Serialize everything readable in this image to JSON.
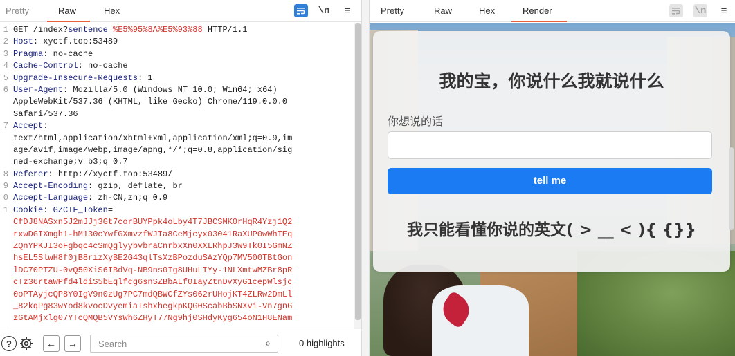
{
  "left_tabs": [
    "Pretty",
    "Raw",
    "Hex"
  ],
  "left_active_tab": "Raw",
  "left_toolbar": {
    "wrap_icon": "wrap-lines-icon",
    "newline_label": "\\n",
    "menu_icon": "hamburger-menu-icon"
  },
  "request_lines": [
    {
      "num": "1",
      "parts": [
        [
          "GET /index?",
          ""
        ],
        [
          "sentence",
          "qparam"
        ],
        [
          "=",
          ""
        ],
        [
          "%E5%95%8A%E5%93%88",
          "qval"
        ],
        [
          " HTTP/1.1",
          ""
        ]
      ]
    },
    {
      "num": "2",
      "parts": [
        [
          "Host",
          "hname"
        ],
        [
          ": xyctf.top:53489",
          ""
        ]
      ]
    },
    {
      "num": "3",
      "parts": [
        [
          "Pragma",
          "hname"
        ],
        [
          ": no-cache",
          ""
        ]
      ]
    },
    {
      "num": "4",
      "parts": [
        [
          "Cache-Control",
          "hname"
        ],
        [
          ": no-cache",
          ""
        ]
      ]
    },
    {
      "num": "5",
      "parts": [
        [
          "Upgrade-Insecure-Requests",
          "hname"
        ],
        [
          ": 1",
          ""
        ]
      ]
    },
    {
      "num": "6",
      "parts": [
        [
          "User-Agent",
          "hname"
        ],
        [
          ": Mozilla/5.0 (Windows NT 10.0; Win64; x64)",
          ""
        ]
      ]
    },
    {
      "num": "",
      "parts": [
        [
          "AppleWebKit/537.36 (KHTML, like Gecko) Chrome/119.0.0.0",
          ""
        ]
      ]
    },
    {
      "num": "",
      "parts": [
        [
          "Safari/537.36",
          ""
        ]
      ]
    },
    {
      "num": "7",
      "parts": [
        [
          "Accept",
          "hname"
        ],
        [
          ":",
          ""
        ]
      ]
    },
    {
      "num": "",
      "parts": [
        [
          "text/html,application/xhtml+xml,application/xml;q=0.9,im",
          ""
        ]
      ]
    },
    {
      "num": "",
      "parts": [
        [
          "age/avif,image/webp,image/apng,*/*;q=0.8,application/sig",
          ""
        ]
      ]
    },
    {
      "num": "",
      "parts": [
        [
          "ned-exchange;v=b3;q=0.7",
          ""
        ]
      ]
    },
    {
      "num": "8",
      "parts": [
        [
          "Referer",
          "hname"
        ],
        [
          ": http://xyctf.top:53489/",
          ""
        ]
      ]
    },
    {
      "num": "9",
      "parts": [
        [
          "Accept-Encoding",
          "hname"
        ],
        [
          ": gzip, deflate, br",
          ""
        ]
      ]
    },
    {
      "num": "0",
      "parts": [
        [
          "Accept-Language",
          "hname"
        ],
        [
          ": zh-CN,zh;q=0.9",
          ""
        ]
      ]
    },
    {
      "num": "1",
      "parts": [
        [
          "Cookie",
          "hname"
        ],
        [
          ": ",
          ""
        ],
        [
          "GZCTF_Token",
          "hname"
        ],
        [
          "=",
          ""
        ]
      ]
    },
    {
      "num": "",
      "parts": [
        [
          "CfDJ8NASxn5J2mJJj3Gt7corBUYPpk4oLby4T7JBCSMK0rHqR4Yzj1Q2",
          "cookie"
        ]
      ]
    },
    {
      "num": "",
      "parts": [
        [
          "rxwDGIXmgh1-hM130cYwfGXmvzfWJIa8CeMjcyx03041RaXUP0wWhTEq",
          "cookie"
        ]
      ]
    },
    {
      "num": "",
      "parts": [
        [
          "ZQnYPKJI3oFgbqc4cSmQglyybvbraCnrbxXn0XXLRhpJ3W9Tk0I5GmNZ",
          "cookie"
        ]
      ]
    },
    {
      "num": "",
      "parts": [
        [
          "hsEL5SlwH8f0jB8rizXyBE2G43qlTsXzBPozduSAzYQp7MV500TBtGon",
          "cookie"
        ]
      ]
    },
    {
      "num": "",
      "parts": [
        [
          "lDC70PTZU-0vQ50XiS6IBdVq-NB9ns0Ig8UHuLIYy-1NLXmtwMZBr8pR",
          "cookie"
        ]
      ]
    },
    {
      "num": "",
      "parts": [
        [
          "cTz36rtaWPfd4ldiS5bEqlfcg6snSZBbALf0IayZtnDvXyG1cepWlsjc",
          "cookie"
        ]
      ]
    },
    {
      "num": "",
      "parts": [
        [
          "0oPTAyjcQP8Y0IgV9n0zUg7PC7mdQBWCfZYs062rUHojKT4ZLRw2DmLl",
          "cookie"
        ]
      ]
    },
    {
      "num": "",
      "parts": [
        [
          "_82kqPg83wYod8kvocDvyemiaTshxhegkpKQG0ScabBbSNXvi-Vn7gnG",
          "cookie"
        ]
      ]
    },
    {
      "num": "",
      "parts": [
        [
          "zGtAMjxlg07YTcQMQB5VYsWh6ZHyT77Ng9hj0SHdyKyg654oN1H8ENam",
          "cookie"
        ]
      ]
    }
  ],
  "bottom_bar": {
    "help_label": "?",
    "back_label": "←",
    "forward_label": "→",
    "search_placeholder": "Search",
    "highlights": "0 highlights"
  },
  "right_tabs": [
    "Pretty",
    "Raw",
    "Hex",
    "Render"
  ],
  "right_active_tab": "Render",
  "right_toolbar": {
    "newline_label": "\\n"
  },
  "render_page": {
    "title": "我的宝，你说什么我就说什么",
    "input_label": "你想说的话",
    "input_value": "",
    "button_label": "tell me",
    "message": "我只能看懂你说的英文( > __ < ){ {}}"
  },
  "colors": {
    "accent_tab": "#e8613c",
    "button_blue": "#1a7bf2",
    "header_name": "#1a237e",
    "cookie_value": "#d3332a"
  }
}
